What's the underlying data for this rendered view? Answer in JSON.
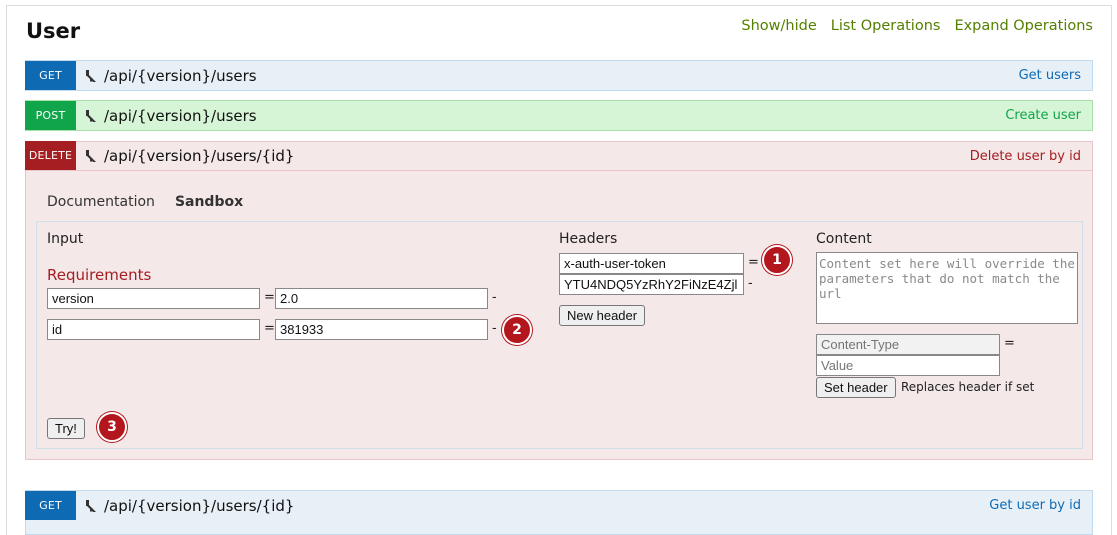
{
  "section": {
    "title": "User"
  },
  "top_links": [
    "Show/hide",
    "List Operations",
    "Expand Operations"
  ],
  "operations": [
    {
      "method": "GET",
      "path": "/api/{version}/users",
      "summary": "Get users"
    },
    {
      "method": "POST",
      "path": "/api/{version}/users",
      "summary": "Create user"
    },
    {
      "method": "DELETE",
      "path": "/api/{version}/users/{id}",
      "summary": "Delete user by id"
    },
    {
      "method": "GET",
      "path": "/api/{version}/users/{id}",
      "summary": "Get user by id"
    }
  ],
  "tabs": {
    "documentation": "Documentation",
    "sandbox": "Sandbox"
  },
  "sandbox": {
    "input_label": "Input",
    "requirements_label": "Requirements",
    "params": [
      {
        "name": "version",
        "value": "2.0"
      },
      {
        "name": "id",
        "value": "381933"
      }
    ],
    "eq": "=",
    "dash": "-",
    "headers_label": "Headers",
    "header_name": "x-auth-user-token",
    "header_value": "YTU4NDQ5YzRhY2FiNzE4Zjl",
    "new_header_button": "New header",
    "content_label": "Content",
    "content_placeholder": "Content set here will override the parameters that do not match the url",
    "content_type_placeholder": "Content-Type",
    "value_placeholder": "Value",
    "set_header_button": "Set header",
    "set_header_hint": "Replaces header if set",
    "try_button": "Try!"
  },
  "badges": [
    "1",
    "2",
    "3"
  ],
  "colors": {
    "get": "#0f6ab4",
    "post": "#10a54a",
    "delete": "#a41e22",
    "links": "#547f00"
  }
}
